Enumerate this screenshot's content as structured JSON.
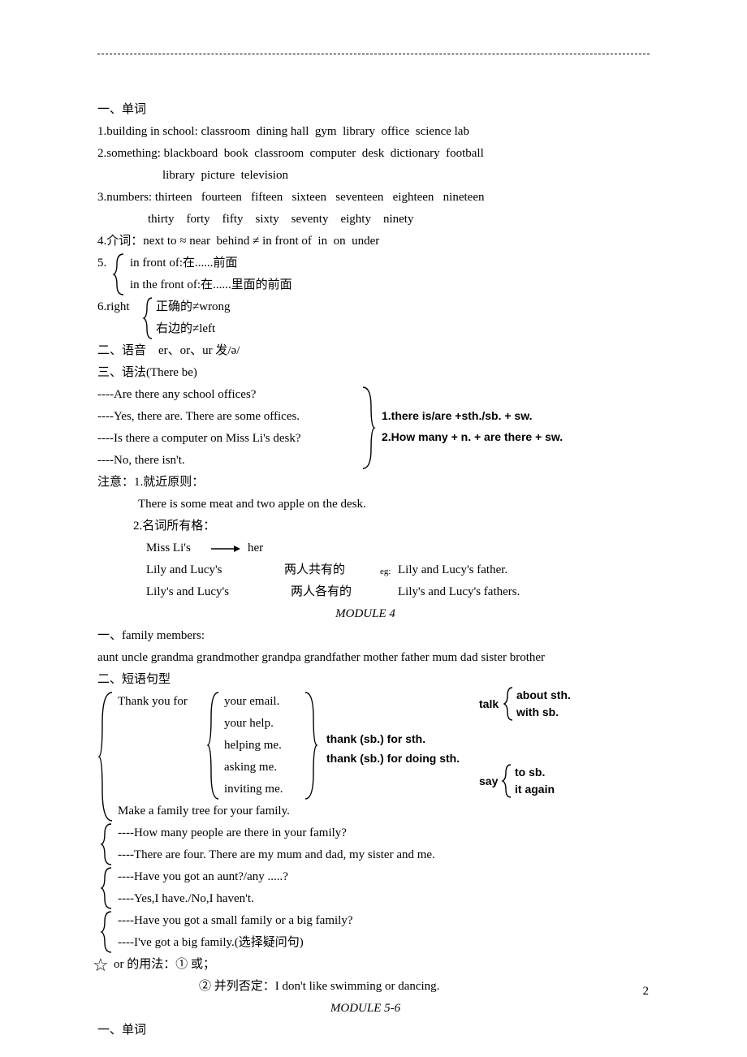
{
  "sec1": {
    "title": "一、单词",
    "l1": "1.building in school: classroom  dining hall  gym  library  office  science lab",
    "l2": "2.something: blackboard  book  classroom  computer  desk  dictionary  football",
    "l2b": "library  picture  television",
    "l3": "3.numbers: thirteen   fourteen   fifteen   sixteen   seventeen   eighteen   nineteen",
    "l3b": "thirty    forty    fifty    sixty    seventy    eighty    ninety",
    "l4": "4.介词：next to ≈ near  behind ≠ in front of  in  on  under",
    "l5a": "5.",
    "l5b": "in front of:在......前面",
    "l5c": "in the front of:在......里面的前面",
    "l6a": "6.right",
    "l6b": "正确的≠wrong",
    "l6c": "右边的≠left"
  },
  "sec2": {
    "title": "二、语音    er、or、ur 发/ə/"
  },
  "sec3": {
    "title": "三、语法(There be)",
    "q1": "----Are there any school offices?",
    "q2": "----Yes, there are. There are some offices.",
    "q3": "----Is there a computer on Miss Li's desk?",
    "q4": "----No, there isn't.",
    "note1": "1.there is/are +sth./sb. + sw.",
    "note2": "2.How many + n. + are there + sw.",
    "zy": "注意：1.就近原则：",
    "zy_ex": "There is some meat and two apple on the desk.",
    "poss_h": "2.名词所有格：",
    "poss1": "Miss Li's",
    "poss1b": "her",
    "poss2a": "Lily and Lucy's",
    "poss2b": "两人共有的",
    "poss2eg": "eg: ",
    "poss2c": "Lily and Lucy's father.",
    "poss3a": "Lily's and Lucy's",
    "poss3b": "两人各有的",
    "poss3c": "Lily's and Lucy's fathers."
  },
  "mod4": "MODULE 4",
  "sec4": {
    "fam_h": "一、family members:",
    "fam": "aunt  uncle  grandma  grandmother  grandpa  grandfather  mother  father  mum  dad  sister  brother",
    "phr_h": "二、短语句型",
    "thank": "Thank you for",
    "opts": [
      "your email.",
      "your help.",
      "helping me.",
      "asking me.",
      "inviting me."
    ],
    "thank_note1": "thank (sb.) for sth.",
    "thank_note2": "thank (sb.) for doing sth.",
    "talk": "talk",
    "talk1": "about sth.",
    "talk2": "with sb.",
    "say": "say",
    "say1": "to sb.",
    "say2": "it again",
    "make": "Make a family tree for your family.",
    "d1a": "----How many people are there in your family?",
    "d1b": "----There are four. There are my mum and dad, my sister and me.",
    "d2a": "----Have you got an aunt?/any .....?",
    "d2b": "----Yes,I have./No,I haven't.",
    "d3a": "----Have you got a small family or a big family?",
    "d3b": "----I've got a big family.(选择疑问句)",
    "or_h": "or 的用法：① 或；",
    "or_b": "② 并列否定：I don't like swimming or dancing."
  },
  "mod56": "MODULE 5-6",
  "sec5_h": "一、单词",
  "pageno": "2"
}
